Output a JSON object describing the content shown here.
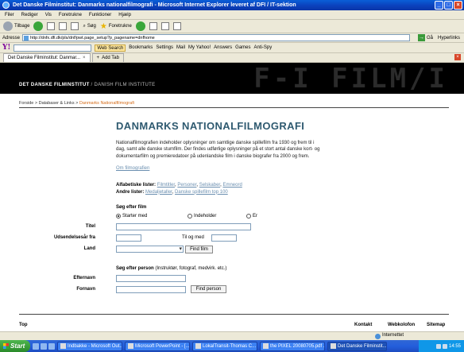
{
  "window": {
    "title": "Det Danske Filminstitut: Danmarks nationalfilmografi - Microsoft Internet Explorer leveret af DFI / IT-sektion"
  },
  "menu": [
    "Filer",
    "Rediger",
    "Vis",
    "Foretrukne",
    "Funktioner",
    "Hjælp"
  ],
  "toolbar": {
    "back": "Tilbage",
    "search": "Søg",
    "favorites": "Foretrukne"
  },
  "address": {
    "label": "Adresse",
    "url": "http://dnfx.dfi.dk/pls/dnf/pwt.page_setup?p_pagename=dnfhome",
    "go": "Gå",
    "links": "Hyperlinks"
  },
  "yahoo": {
    "logo": "Y!",
    "search": "Web Search",
    "items": [
      "Bookmarks",
      "Settings",
      "Mail",
      "My Yahoo!",
      "Answers",
      "Games",
      "Anti-Spy"
    ]
  },
  "tabs": [
    {
      "label": "Det Danske Filminstitut: Danmar..."
    },
    {
      "label": "Add Tab"
    }
  ],
  "banner": {
    "title": "DET DANSKE FILMINSTITUT",
    "subtitle": " / DANISH FILM INSTITUTE",
    "deco": "F-I FILM/I"
  },
  "breadcrumb": {
    "home": "Forside",
    "sep1": " > ",
    "db": "Databaser & Links",
    "sep2": " > ",
    "current": "Danmarks Nationalfilmografi"
  },
  "main": {
    "heading": "DANMARKS NATIONALFILMOGRAFI",
    "intro": "Nationalfilmografien indeholder oplysninger om samtlige danske spillefilm fra 1930 og frem til i dag, samt alle danske stumfilm. Der findes udførlige oplysninger på et stort antal danske kort- og dokumentarfilm og premieredatoer på udenlandske film i danske biografer fra 2000 og frem.",
    "about_link": "Om filmografien",
    "alpha_label": "Alfabetiske lister:",
    "alpha_links": [
      "Filmtitler",
      "Personer",
      "Selskaber",
      "Emneord"
    ],
    "other_label": "Andre lister:",
    "other_links": [
      "Medaljetaller",
      "Danske spillefilm top 100"
    ]
  },
  "film_search": {
    "title": "Søg efter film",
    "radio": [
      "Starter med",
      "Indeholder",
      "Er"
    ],
    "titel_label": "Titel",
    "year_label": "Udsendelsesår fra",
    "to_label": "Til og med",
    "land_label": "Land",
    "button": "Find film"
  },
  "person_search": {
    "title": "Søg efter person",
    "hint": " (Instruktør, fotograf, medvirk. etc.)",
    "efternavn_label": "Efternavn",
    "fornavn_label": "Fornavn",
    "button": "Find person"
  },
  "footer": {
    "top": "Top",
    "contact": "Kontakt",
    "webkolofon": "Webkolofon",
    "sitemap": "Sitemap"
  },
  "status": {
    "zone": "Internettet"
  },
  "taskbar": {
    "start": "Start",
    "tasks": [
      "Indbakke - Microsoft Out...",
      "Microsoft PowerPoint - [...",
      "LokalTransit-Thomas C...",
      "the PIXEL 20080705.pdf ...",
      "Det Danske Filminstit..."
    ],
    "time": "14:55"
  }
}
